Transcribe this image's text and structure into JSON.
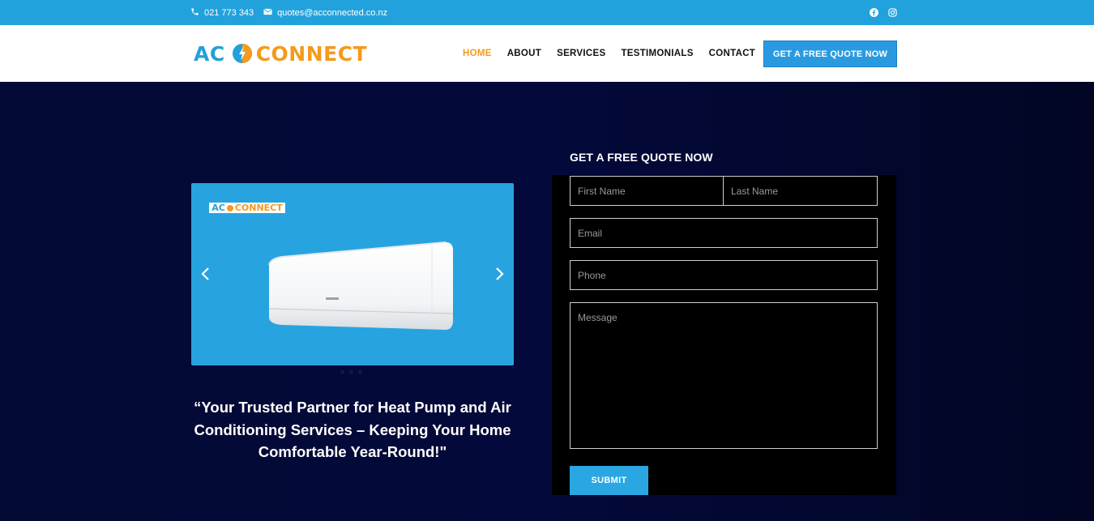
{
  "topbar": {
    "phone": "021 773 343",
    "email": "quotes@acconnected.co.nz",
    "icons": [
      "phone-icon",
      "mail-icon",
      "facebook-icon",
      "instagram-icon"
    ]
  },
  "logo": {
    "ac": "AC",
    "connect": "CONNECT"
  },
  "nav": {
    "items": [
      {
        "label": "HOME",
        "active": true
      },
      {
        "label": "ABOUT",
        "active": false
      },
      {
        "label": "SERVICES",
        "active": false
      },
      {
        "label": "TESTIMONIALS",
        "active": false
      },
      {
        "label": "CONTACT",
        "active": false
      }
    ],
    "cta": "GET A FREE QUOTE NOW"
  },
  "hero": {
    "slider": {
      "logo_ac": "AC",
      "logo_connect": "CONNECT",
      "slide_count": 3,
      "active_slide": 1
    },
    "tagline": "“Your Trusted Partner for Heat Pump and Air Conditioning Services – Keeping Your Home Comfortable Year-Round!\""
  },
  "form": {
    "title": "GET A FREE QUOTE NOW",
    "first_name": {
      "placeholder": "First Name",
      "value": ""
    },
    "last_name": {
      "placeholder": "Last Name",
      "value": ""
    },
    "email": {
      "placeholder": "Email",
      "value": ""
    },
    "phone": {
      "placeholder": "Phone",
      "value": ""
    },
    "message": {
      "placeholder": "Message",
      "value": ""
    },
    "submit": "SUBMIT"
  },
  "colors": {
    "topbar": "#22a2dc",
    "brand_blue": "#24a0d8",
    "brand_orange": "#f49a1c",
    "hero_bg": "#03093a",
    "submit": "#2aa7e3"
  }
}
